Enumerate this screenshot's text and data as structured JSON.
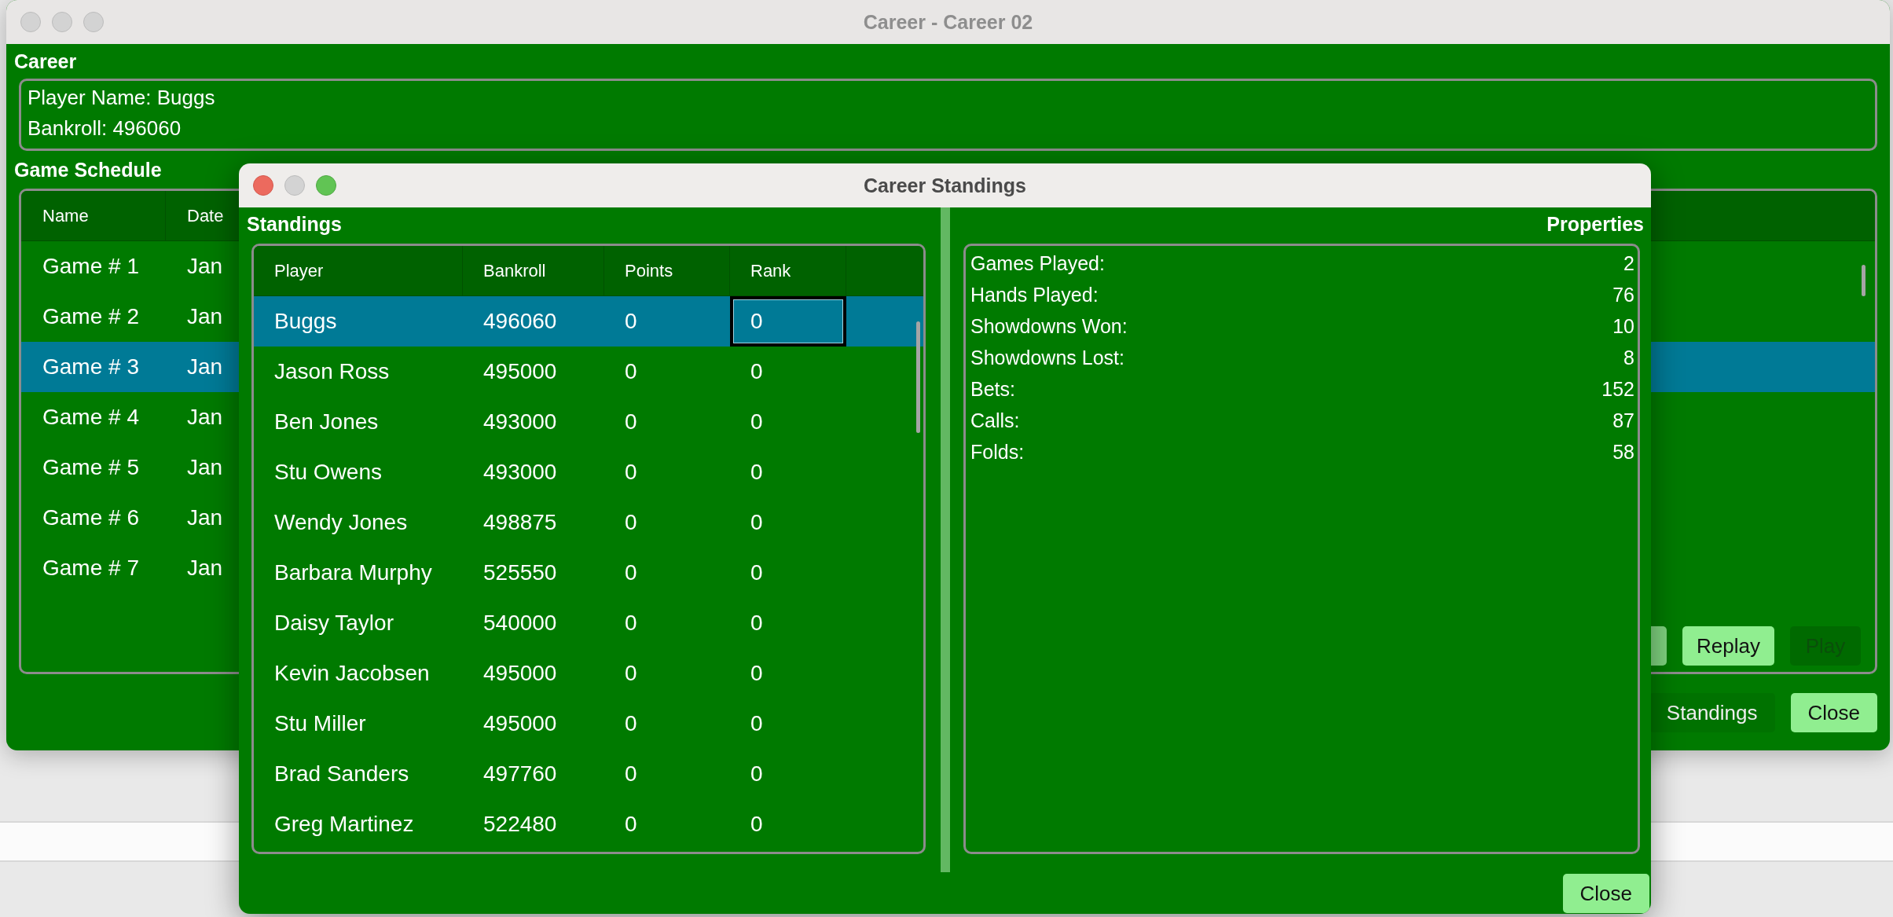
{
  "main_window": {
    "title": "Career - Career 02",
    "career_heading": "Career",
    "career_info": [
      "Player Name: Buggs",
      "Bankroll: 496060"
    ],
    "schedule_heading": "Game Schedule",
    "schedule_table": {
      "columns": [
        "Name",
        "Date"
      ],
      "rows": [
        {
          "name": "Game # 1",
          "date": "Jan",
          "selected": false
        },
        {
          "name": "Game # 2",
          "date": "Jan",
          "selected": false
        },
        {
          "name": "Game # 3",
          "date": "Jan",
          "selected": true
        },
        {
          "name": "Game # 4",
          "date": "Jan",
          "selected": false
        },
        {
          "name": "Game # 5",
          "date": "Jan",
          "selected": false
        },
        {
          "name": "Game # 6",
          "date": "Jan",
          "selected": false
        },
        {
          "name": "Game # 7",
          "date": "Jan",
          "selected": false
        }
      ]
    },
    "table_buttons": [
      {
        "label": "Replay",
        "disabled": false
      },
      {
        "label": "Play",
        "disabled": true
      }
    ],
    "footer_buttons": [
      {
        "label": "Standings",
        "kind": "plain"
      },
      {
        "label": "Close",
        "kind": "primary"
      }
    ]
  },
  "dialog": {
    "title": "Career Standings",
    "standings_heading": "Standings",
    "properties_heading": "Properties",
    "standings_table": {
      "columns": [
        "Player",
        "Bankroll",
        "Points",
        "Rank"
      ],
      "rows": [
        {
          "player": "Buggs",
          "bankroll": "496060",
          "points": "0",
          "rank": "0",
          "selected": true,
          "rank_focused": true
        },
        {
          "player": "Jason Ross",
          "bankroll": "495000",
          "points": "0",
          "rank": "0",
          "selected": false,
          "rank_focused": false
        },
        {
          "player": "Ben Jones",
          "bankroll": "493000",
          "points": "0",
          "rank": "0",
          "selected": false,
          "rank_focused": false
        },
        {
          "player": "Stu Owens",
          "bankroll": "493000",
          "points": "0",
          "rank": "0",
          "selected": false,
          "rank_focused": false
        },
        {
          "player": "Wendy Jones",
          "bankroll": "498875",
          "points": "0",
          "rank": "0",
          "selected": false,
          "rank_focused": false
        },
        {
          "player": "Barbara Murphy",
          "bankroll": "525550",
          "points": "0",
          "rank": "0",
          "selected": false,
          "rank_focused": false
        },
        {
          "player": "Daisy Taylor",
          "bankroll": "540000",
          "points": "0",
          "rank": "0",
          "selected": false,
          "rank_focused": false
        },
        {
          "player": "Kevin Jacobsen",
          "bankroll": "495000",
          "points": "0",
          "rank": "0",
          "selected": false,
          "rank_focused": false
        },
        {
          "player": "Stu Miller",
          "bankroll": "495000",
          "points": "0",
          "rank": "0",
          "selected": false,
          "rank_focused": false
        },
        {
          "player": "Brad Sanders",
          "bankroll": "497760",
          "points": "0",
          "rank": "0",
          "selected": false,
          "rank_focused": false
        },
        {
          "player": "Greg Martinez",
          "bankroll": "522480",
          "points": "0",
          "rank": "0",
          "selected": false,
          "rank_focused": false
        }
      ]
    },
    "properties": [
      {
        "label": "Games Played:",
        "value": "2"
      },
      {
        "label": "Hands Played:",
        "value": "76"
      },
      {
        "label": "Showdowns Won:",
        "value": "10"
      },
      {
        "label": "Showdowns Lost:",
        "value": "8"
      },
      {
        "label": "Bets:",
        "value": "152"
      },
      {
        "label": "Calls:",
        "value": "87"
      },
      {
        "label": "Folds:",
        "value": "58"
      }
    ],
    "close_button": "Close"
  }
}
